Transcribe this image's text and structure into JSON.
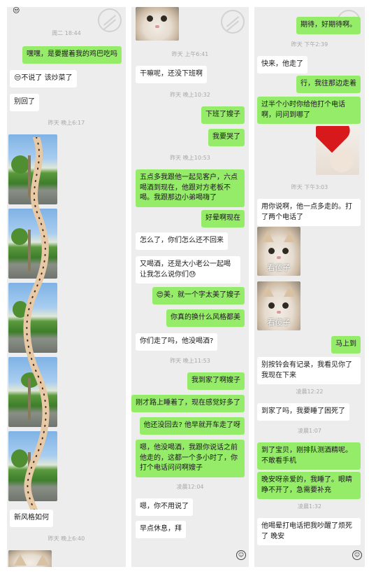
{
  "panel1": {
    "top_emoji": "😒",
    "time1": "周二 18:44",
    "msg1": "嘿嘿，是要握着我的鸡巴吃吗",
    "msg2": "😒不说了 该炒菜了",
    "msg3": "别回了",
    "time2": "昨天 晚上6:17",
    "msg4": "新风格如何",
    "time3": "昨天 晚上6:40"
  },
  "panel2": {
    "time1": "昨天 上午6:41",
    "msg1": "干嘛呢，还没下班啊",
    "time2": "昨天 晚上10:32",
    "msg2": "下班了嫂子",
    "msg3": "我要哭了",
    "time3": "昨天 晚上10:53",
    "msg4": "五点多我跟他一起见客户，六点喝酒到现在，他跟对方老板不喝。我跟那边小弟喝嗨了",
    "msg5": "好晕啊现在",
    "msg6": "怎么了，你们怎么还不回来",
    "msg7": "又喝酒，还是大小老公一起喝 让我怎么说你们😓",
    "msg8": "😍美，就一个字太美了嫂子",
    "msg9": "你真的换什么风格都美",
    "msg10": "你们走了吗，他没喝酒?",
    "time4": "昨天 晚上11:53",
    "msg11": "我到家了啊嫂子",
    "msg12": "刚才路上睡着了，现在感觉好多了",
    "msg13": "他还没回去? 他早就开车走了呀",
    "msg14": "嗯，他没喝酒，我跟你说话之前他走的，这都一个多小时了，你打个电话问问啊嫂子",
    "time5": "凌晨12:04",
    "msg15": "嗯，你不用说了",
    "msg16": "早点休息，拜"
  },
  "panel3": {
    "msg1": "期待，好期待啊。",
    "time1": "昨天 下午2:39",
    "msg2": "快来，他走了",
    "msg3": "行，我往那边走着",
    "msg4": "过半个小时你给他打个电话啊，问问到哪了",
    "time2": "昨天 下午3:03",
    "msg5": "用你说啊，他一点多走的。打了两个电话了",
    "sticker_caption": "看傻子",
    "msg6": "马上到",
    "msg7": "别按铃会有记录，我看见你了我现在下来",
    "time3": "凌晨12:22",
    "msg8": "到家了吗，我要睡了困死了",
    "time4": "凌晨1:07",
    "msg9": "到了宝贝，刚排队测酒精呢。不敢看手机",
    "msg10": "晚安呀亲爱的，我睡了。眼睛睁不开了，急需要补充",
    "time5": "凌晨1:32",
    "msg11": "他喝晕打电话把我吵醒了烦死了 晚安"
  },
  "icons": {
    "watermark": "circle-slash-watermark-icon",
    "emoji_button": "smiley-icon"
  },
  "colors": {
    "me_bubble": "#95ec69",
    "them_bubble": "#ffffff",
    "background": "#ededed",
    "timestamp": "#a8a8a8"
  }
}
